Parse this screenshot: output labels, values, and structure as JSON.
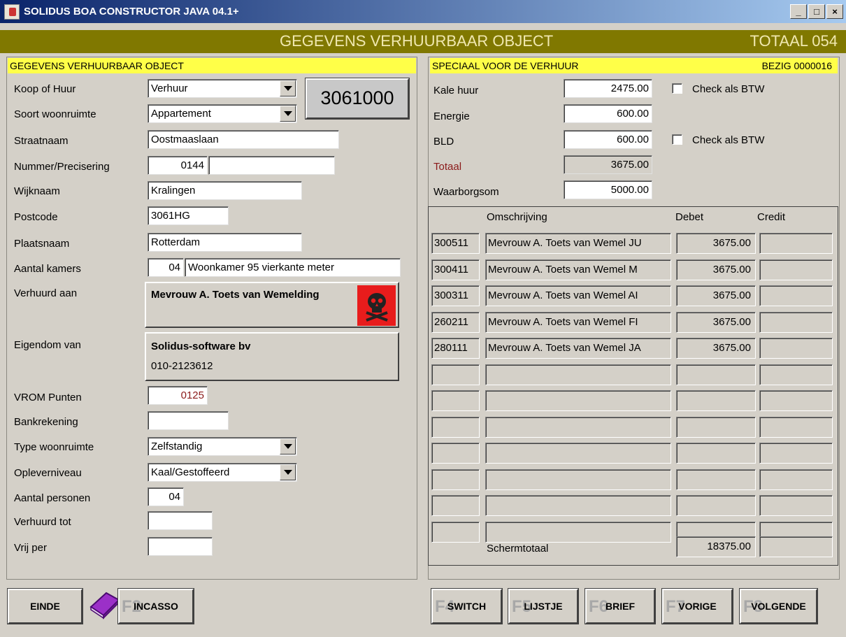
{
  "window": {
    "title": "SOLIDUS BOA CONSTRUCTOR JAVA 04.1+",
    "minimize": "_",
    "maximize": "□",
    "close": "×"
  },
  "banner": {
    "title": "GEGEVENS VERHUURBAAR OBJECT",
    "total": "TOTAAL  054"
  },
  "left": {
    "header": "GEGEVENS VERHUURBAAR OBJECT",
    "labels": {
      "koop_huur": "Koop of Huur",
      "soort": "Soort woonruimte",
      "straat": "Straatnaam",
      "nummer": "Nummer/Precisering",
      "wijk": "Wijknaam",
      "postcode": "Postcode",
      "plaats": "Plaatsnaam",
      "kamers": "Aantal kamers",
      "verhuurd_aan": "Verhuurd aan",
      "eigendom": "Eigendom van",
      "vrom": "VROM Punten",
      "bank": "Bankrekening",
      "type": "Type woonruimte",
      "oplever": "Opleverniveau",
      "personen": "Aantal personen",
      "verhuurd_tot": "Verhuurd tot",
      "vrij_per": "Vrij per"
    },
    "values": {
      "koop_huur": "Verhuur",
      "soort": "Appartement",
      "straat": "Oostmaaslaan",
      "nummer": "0144",
      "precisering": "",
      "wijk": "Kralingen",
      "postcode": "3061HG",
      "plaats": "Rotterdam",
      "kamers": "04",
      "kamers_omschr": "Woonkamer 95 vierkante meter",
      "verhuurd_aan": "Mevrouw A. Toets van Wemelding",
      "eigendom_naam": "Solidus-software bv",
      "eigendom_tel": "010-2123612",
      "vrom": "0125",
      "bank": "",
      "type": "Zelfstandig",
      "oplever": "Kaal/Gestoffeerd",
      "personen": "04",
      "verhuurd_tot": "",
      "vrij_per": ""
    },
    "object_code": "3061000"
  },
  "right": {
    "header": "SPECIAAL VOOR DE VERHUUR",
    "status": "BEZIG  0000016",
    "labels": {
      "kale_huur": "Kale huur",
      "energie": "Energie",
      "bld": "BLD",
      "totaal": "Totaal",
      "waarborg": "Waarborgsom"
    },
    "values": {
      "kale_huur": "2475.00",
      "energie": "600.00",
      "bld": "600.00",
      "totaal": "3675.00",
      "waarborg": "5000.00"
    },
    "check_label": "Check als BTW",
    "table": {
      "headers": {
        "omschrijving": "Omschrijving",
        "debet": "Debet",
        "credit": "Credit"
      },
      "rows": [
        {
          "code": "300511",
          "omschr": "Mevrouw A. Toets van Wemel JU",
          "debet": "3675.00",
          "credit": ""
        },
        {
          "code": "300411",
          "omschr": "Mevrouw A. Toets van Wemel M",
          "debet": "3675.00",
          "credit": ""
        },
        {
          "code": "300311",
          "omschr": "Mevrouw A. Toets van Wemel AI",
          "debet": "3675.00",
          "credit": ""
        },
        {
          "code": "260211",
          "omschr": "Mevrouw A. Toets van Wemel FI",
          "debet": "3675.00",
          "credit": ""
        },
        {
          "code": "280111",
          "omschr": "Mevrouw A. Toets van Wemel JA",
          "debet": "3675.00",
          "credit": ""
        }
      ],
      "total_label": "Schermtotaal",
      "total_debet": "18375.00",
      "total_credit": ""
    }
  },
  "buttons": {
    "einde": "EINDE",
    "incasso": "INCASSO",
    "switch": "SWITCH",
    "lijstje": "LIJSTJE",
    "brief": "BRIEF",
    "vorige": "VORIGE",
    "volgende": "VOLGENDE"
  },
  "fkeys": {
    "incasso": "F2",
    "switch": "F4",
    "lijstje": "F5",
    "brief": "F6",
    "vorige": "F7",
    "volgende": "F8"
  },
  "colors": {
    "banner": "#807800",
    "header_yellow": "#ffff48",
    "skull_red": "#e81c1c",
    "book_purple": "#9b30c8"
  }
}
